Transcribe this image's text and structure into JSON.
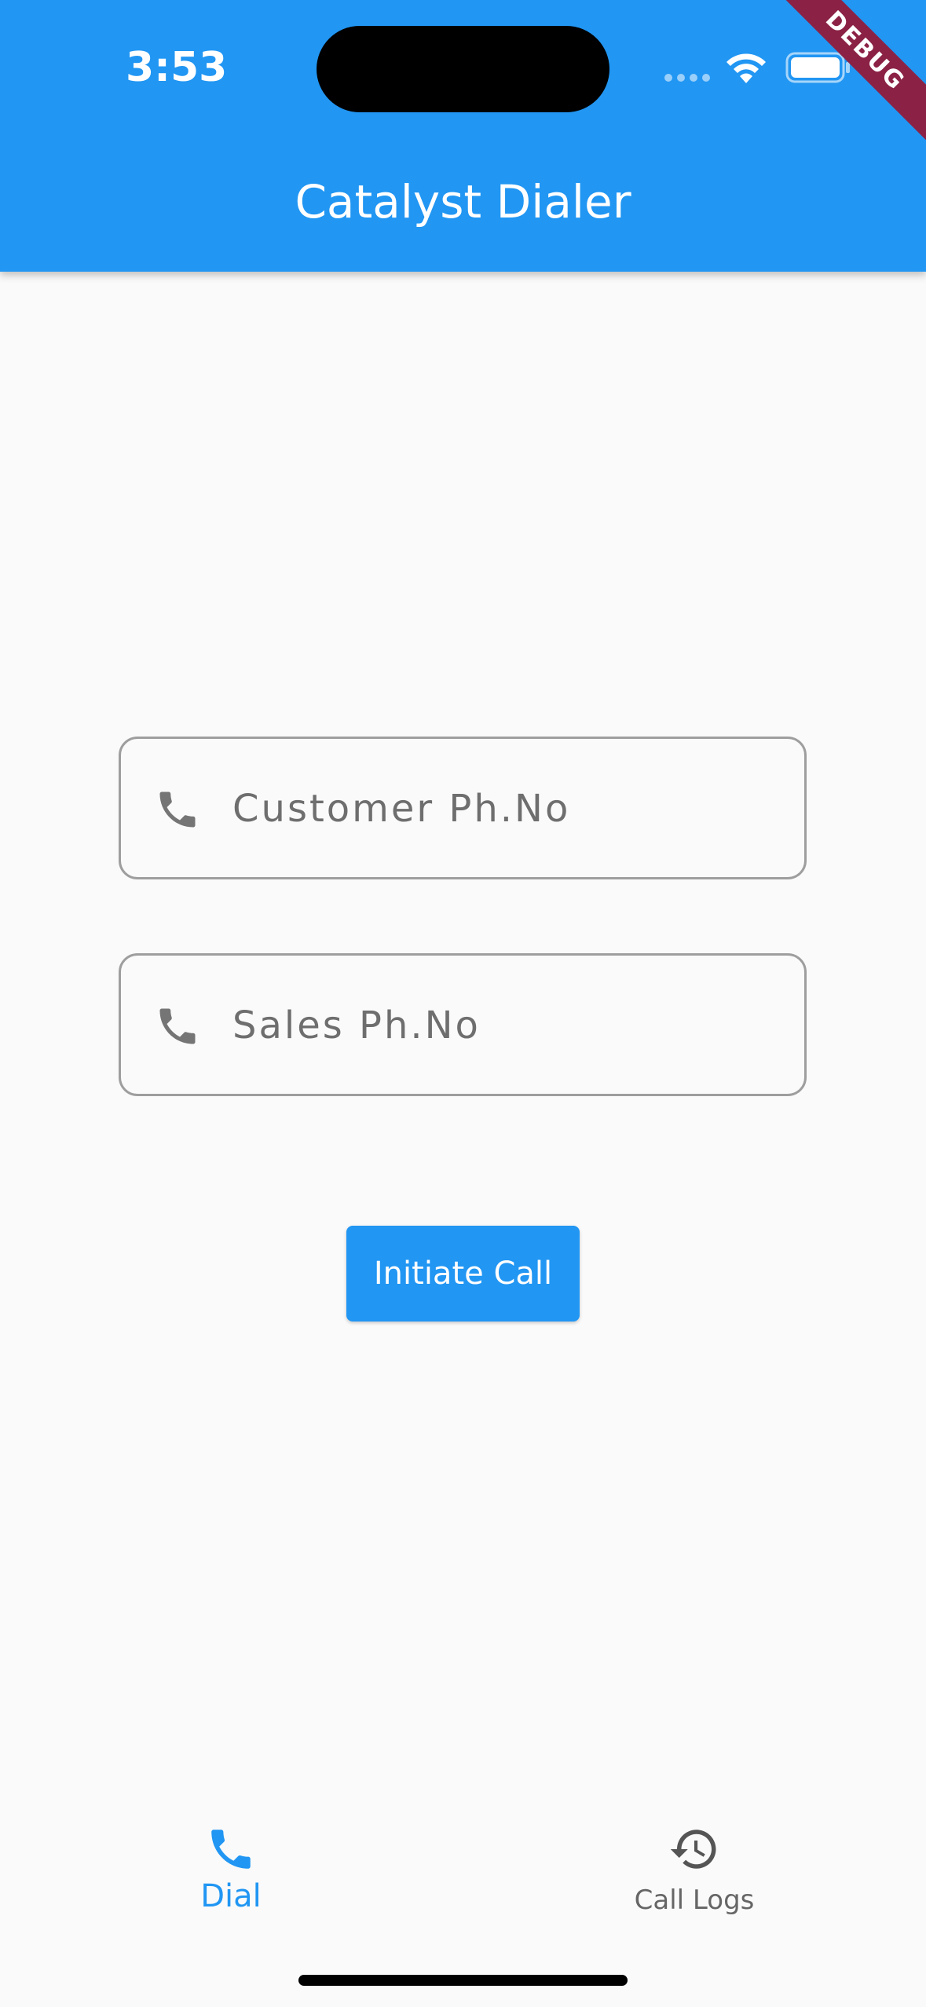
{
  "status_bar": {
    "time": "3:53",
    "icons": [
      "signal-dots-icon",
      "wifi-icon",
      "battery-icon"
    ]
  },
  "app_bar": {
    "title": "Catalyst Dialer",
    "debug_banner": "DEBUG",
    "color": "#2196f3"
  },
  "form": {
    "customer_field": {
      "placeholder": "Customer Ph.No",
      "value": "",
      "icon": "phone-icon"
    },
    "sales_field": {
      "placeholder": "Sales Ph.No",
      "value": "",
      "icon": "phone-icon"
    },
    "submit_label": "Initiate Call"
  },
  "bottom_nav": {
    "items": [
      {
        "label": "Dial",
        "icon": "phone-icon",
        "active": true
      },
      {
        "label": "Call Logs",
        "icon": "history-icon",
        "active": false
      }
    ],
    "active_color": "#2196f3",
    "inactive_color": "#666666"
  }
}
